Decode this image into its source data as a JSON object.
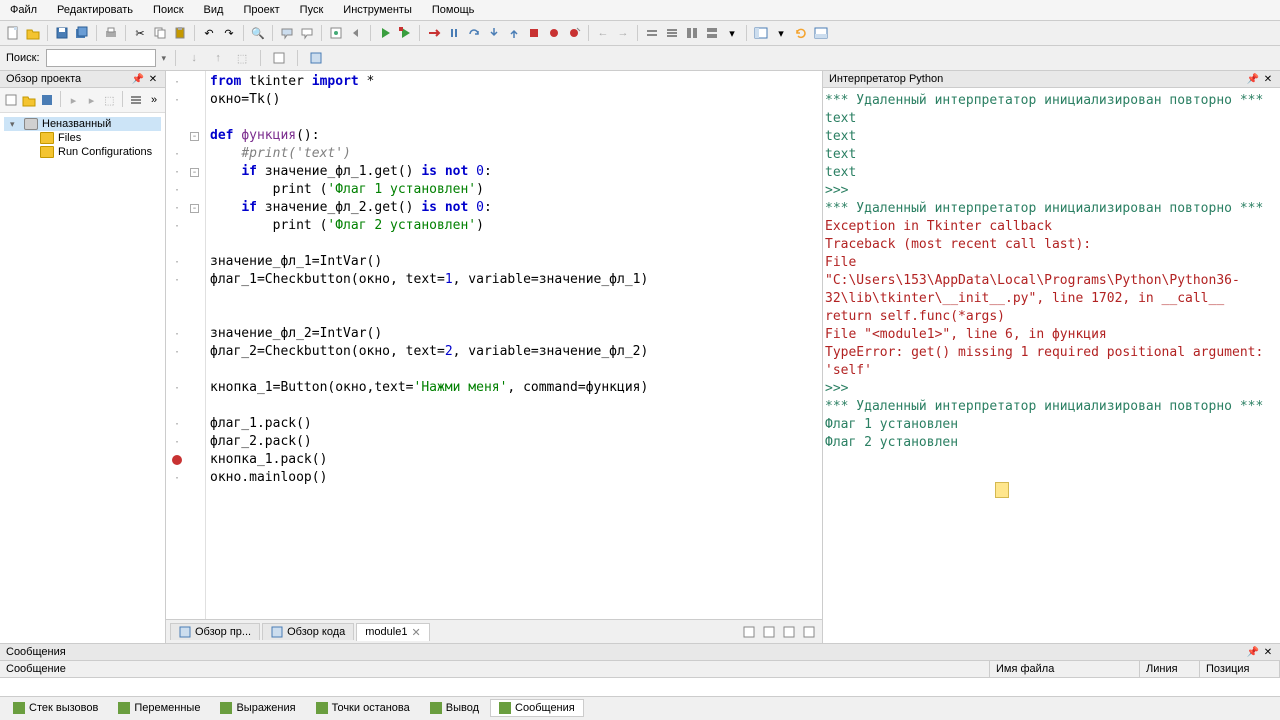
{
  "menu": [
    "Файл",
    "Редактировать",
    "Поиск",
    "Вид",
    "Проект",
    "Пуск",
    "Инструменты",
    "Помощь"
  ],
  "search": {
    "label": "Поиск:",
    "value": ""
  },
  "project_panel": {
    "title": "Обзор проекта",
    "tree": [
      {
        "label": "Неназванный",
        "level": 0,
        "expanded": true,
        "icon": "disk",
        "selected": true
      },
      {
        "label": "Files",
        "level": 1,
        "icon": "folder"
      },
      {
        "label": "Run Configurations",
        "level": 1,
        "icon": "folder"
      }
    ]
  },
  "editor_tabs": {
    "left": [
      {
        "label": "Обзор пр...",
        "icon": "explorer"
      },
      {
        "label": "Обзор кода",
        "icon": "code"
      }
    ],
    "files": [
      {
        "label": "module1",
        "closable": true
      }
    ]
  },
  "code": [
    {
      "t": "from",
      "c": "kw",
      "rest": [
        " tkinter ",
        {
          "t": "import",
          "c": "kw"
        },
        " *"
      ],
      "dash": true
    },
    {
      "plain": "окно=Tk()",
      "dash": true
    },
    {
      "plain": ""
    },
    {
      "fold": "-",
      "parts": [
        {
          "t": "def",
          "c": "kw"
        },
        " ",
        {
          "t": "функция",
          "c": "fn"
        },
        "():"
      ]
    },
    {
      "fold": "",
      "parts": [
        "    ",
        {
          "t": "#print('text')",
          "c": "cmt"
        }
      ],
      "dash": true
    },
    {
      "fold": "-",
      "parts": [
        "    ",
        {
          "t": "if",
          "c": "kw"
        },
        " значение_фл_1.get() ",
        {
          "t": "is not",
          "c": "kw"
        },
        " ",
        {
          "t": "0",
          "c": "num"
        },
        ":"
      ],
      "dash": true
    },
    {
      "parts": [
        "        print (",
        {
          "t": "'Флаг 1 установлен'",
          "c": "str"
        },
        ")"
      ],
      "dash": true
    },
    {
      "fold": "-",
      "parts": [
        "    ",
        {
          "t": "if",
          "c": "kw"
        },
        " значение_фл_2.get() ",
        {
          "t": "is not",
          "c": "kw"
        },
        " ",
        {
          "t": "0",
          "c": "num"
        },
        ":"
      ],
      "dash": true
    },
    {
      "parts": [
        "        print (",
        {
          "t": "'Флаг 2 установлен'",
          "c": "str"
        },
        ")"
      ],
      "dash": true
    },
    {
      "plain": ""
    },
    {
      "parts": [
        "значение_фл_1=IntVar()"
      ],
      "dash": true
    },
    {
      "parts": [
        "флаг_1=Checkbutton(окно, text=",
        {
          "t": "1",
          "c": "num"
        },
        ", variable=значение_фл_1)"
      ],
      "dash": true
    },
    {
      "plain": ""
    },
    {
      "plain": ""
    },
    {
      "parts": [
        "значение_фл_2=IntVar()"
      ],
      "dash": true
    },
    {
      "parts": [
        "флаг_2=Checkbutton(окно, text=",
        {
          "t": "2",
          "c": "num"
        },
        ", variable=значение_фл_2)"
      ],
      "dash": true
    },
    {
      "plain": ""
    },
    {
      "parts": [
        "кнопка_1=Button(окно,text=",
        {
          "t": "'Нажми меня'",
          "c": "str"
        },
        ", command=функция)"
      ],
      "dash": true
    },
    {
      "plain": ""
    },
    {
      "parts": [
        "флаг_1.pack()"
      ],
      "dash": true
    },
    {
      "parts": [
        "флаг_2.pack()"
      ],
      "dash": true
    },
    {
      "parts": [
        "кнопка_1.pack()"
      ],
      "breakpoint": true
    },
    {
      "parts": [
        "окно.mainloop()"
      ],
      "dash": true
    }
  ],
  "interpreter": {
    "title": "Интерпретатор Python",
    "lines": [
      {
        "text": "*** Удаленный интерпретатор инициализирован повторно ***",
        "cls": "out-init"
      },
      {
        "text": "text",
        "cls": "out-text"
      },
      {
        "text": "text",
        "cls": "out-text"
      },
      {
        "text": "text",
        "cls": "out-text"
      },
      {
        "text": "text",
        "cls": "out-text"
      },
      {
        "text": ">>>",
        "cls": "out-prompt"
      },
      {
        "text": "*** Удаленный интерпретатор инициализирован повторно ***",
        "cls": "out-init"
      },
      {
        "text": "Exception in Tkinter callback",
        "cls": "out-err"
      },
      {
        "text": "Traceback (most recent call last):",
        "cls": "out-err"
      },
      {
        "text": "  File \"C:\\Users\\153\\AppData\\Local\\Programs\\Python\\Python36-32\\lib\\tkinter\\__init__.py\", line 1702, in __call__",
        "cls": "out-err"
      },
      {
        "text": "    return self.func(*args)",
        "cls": "out-err"
      },
      {
        "text": "  File \"<module1>\", line 6, in функция",
        "cls": "out-err"
      },
      {
        "text": "TypeError: get() missing 1 required positional argument: 'self'",
        "cls": "out-err"
      },
      {
        "text": ">>>",
        "cls": "out-prompt"
      },
      {
        "text": "*** Удаленный интерпретатор инициализирован повторно ***",
        "cls": "out-init"
      },
      {
        "text": "Флаг 1 установлен",
        "cls": "out-text"
      },
      {
        "text": "Флаг 2 установлен",
        "cls": "out-text"
      }
    ]
  },
  "messages": {
    "title": "Сообщения",
    "cols": [
      "Сообщение",
      "Имя файла",
      "Линия",
      "Позиция"
    ]
  },
  "bottom_tabs": [
    {
      "label": "Стек вызовов"
    },
    {
      "label": "Переменные"
    },
    {
      "label": "Выражения"
    },
    {
      "label": "Точки останова"
    },
    {
      "label": "Вывод"
    },
    {
      "label": "Сообщения",
      "active": true
    }
  ]
}
